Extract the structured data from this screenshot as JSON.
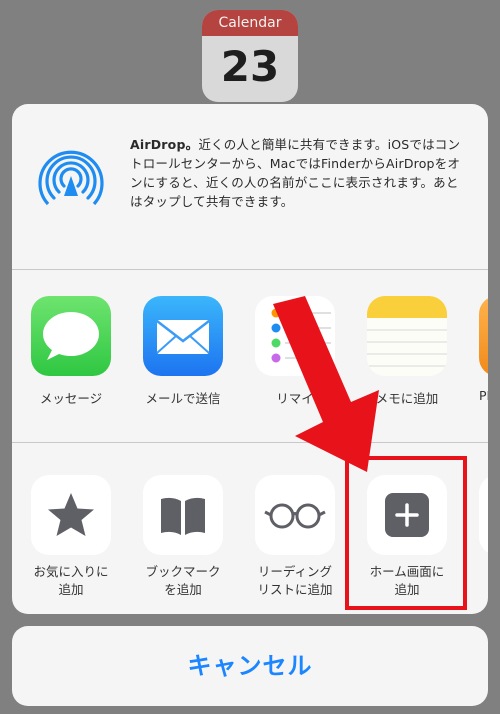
{
  "background": {
    "calendar_month": "Calendar",
    "calendar_day": "23"
  },
  "airdrop": {
    "title": "AirDrop。",
    "description": "近くの人と簡単に共有できます。iOSではコントロールセンターから、MacではFinderからAirDropをオンにすると、近くの人の名前がここに表示されます。あとはタップして共有できます。"
  },
  "apps": [
    {
      "label": "メッセージ",
      "icon": "messages-icon"
    },
    {
      "label": "メールで送信",
      "icon": "mail-icon"
    },
    {
      "label": "リマイ",
      "icon": "reminders-icon"
    },
    {
      "label": "メモに追加",
      "icon": "notes-icon"
    },
    {
      "label": "PD",
      "icon": "pdf-icon"
    }
  ],
  "actions": [
    {
      "label": "お気に入りに\n追加",
      "icon": "star-icon"
    },
    {
      "label": "ブックマーク\nを追加",
      "icon": "book-icon"
    },
    {
      "label": "リーディング\nリストに追加",
      "icon": "glasses-icon"
    },
    {
      "label": "ホーム画面に\n追加",
      "icon": "plus-square-icon"
    }
  ],
  "cancel_label": "キャンセル",
  "colors": {
    "accent_blue": "#1b86ff",
    "annotation_red": "#e8121a",
    "sheet_bg": "#f5f5f5"
  }
}
